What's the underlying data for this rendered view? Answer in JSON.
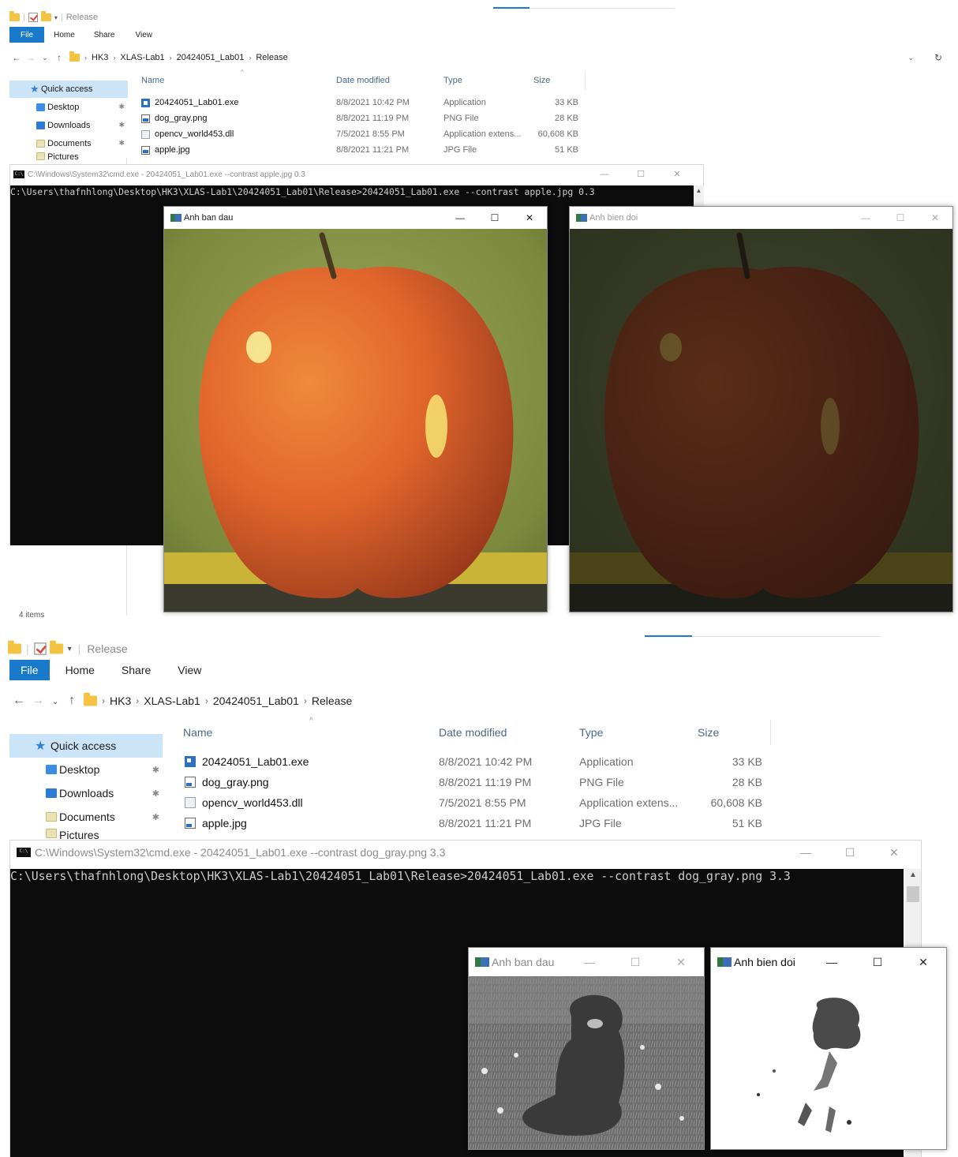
{
  "explorer": {
    "folder_title": "Release",
    "ribbon_tabs": [
      "File",
      "Home",
      "Share",
      "View"
    ],
    "breadcrumb": [
      "HK3",
      "XLAS-Lab1",
      "20424051_Lab01",
      "Release"
    ],
    "nav": {
      "quick_access": "Quick access",
      "items": [
        "Desktop",
        "Downloads",
        "Documents",
        "Pictures"
      ]
    },
    "columns": [
      "Name",
      "Date modified",
      "Type",
      "Size"
    ],
    "files": [
      {
        "name": "20424051_Lab01.exe",
        "date": "8/8/2021 10:42 PM",
        "type": "Application",
        "size": "33 KB",
        "icon": "exe-icon"
      },
      {
        "name": "dog_gray.png",
        "date": "8/8/2021 11:19 PM",
        "type": "PNG File",
        "size": "28 KB",
        "icon": "image-file-icon"
      },
      {
        "name": "opencv_world453.dll",
        "date": "7/5/2021 8:55 PM",
        "type": "Application extens...",
        "size": "60,608 KB",
        "icon": "dll-file-icon"
      },
      {
        "name": "apple.jpg",
        "date": "8/8/2021 11:21 PM",
        "type": "JPG File",
        "size": "51 KB",
        "icon": "image-file-icon"
      }
    ],
    "status": "4 items"
  },
  "cmd_a": {
    "title": "C:\\Windows\\System32\\cmd.exe - 20424051_Lab01.exe  --contrast apple.jpg 0.3",
    "line": "C:\\Users\\thafnhlong\\Desktop\\HK3\\XLAS-Lab1\\20424051_Lab01\\Release>20424051_Lab01.exe --contrast apple.jpg 0.3"
  },
  "cmd_b": {
    "title": "C:\\Windows\\System32\\cmd.exe - 20424051_Lab01.exe  --contrast dog_gray.png 3.3",
    "line": "C:\\Users\\thafnhlong\\Desktop\\HK3\\XLAS-Lab1\\20424051_Lab01\\Release>20424051_Lab01.exe --contrast dog_gray.png 3.3"
  },
  "windows": {
    "original": "Anh ban dau",
    "transformed": "Anh bien doi",
    "minimize": "—",
    "maximize": "☐",
    "close": "✕"
  },
  "window_buttons": [
    "—",
    "☐",
    "✕"
  ],
  "icons": {
    "console": "C:\\",
    "star": "★",
    "pin": "📌",
    "up": "↑",
    "back": "←",
    "forward": "→",
    "down": "⌄",
    "refresh": "↻",
    "chev": "›",
    "sort": "^"
  },
  "colors": {
    "accent": "#1979ca",
    "selected_nav": "#cce4f7",
    "console_bg": "#0c0c0c"
  },
  "contrast_factor_a": 0.3,
  "contrast_factor_b": 3.3
}
